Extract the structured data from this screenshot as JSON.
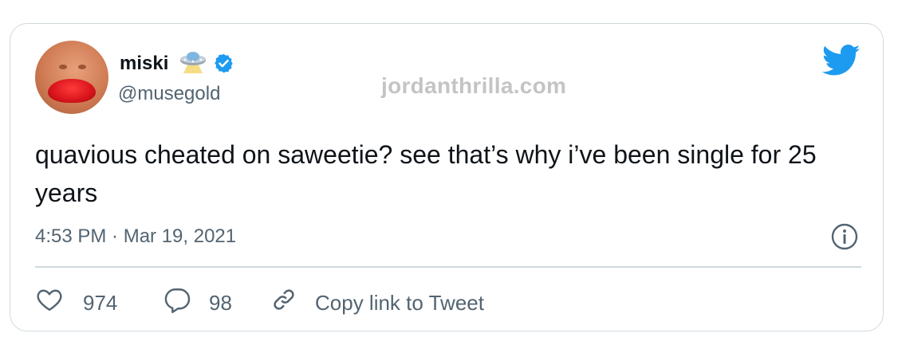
{
  "tweet": {
    "author": {
      "name": "miski",
      "handle": "@musegold",
      "badges": [
        "ufo-icon",
        "verified-icon"
      ]
    },
    "watermark": "jordanthrilla.com",
    "text": "quavious cheated on saweetie? see that’s why i’ve been single for 25 years",
    "timestamp": "4:53 PM · Mar 19, 2021",
    "actions": {
      "like_count": "974",
      "reply_count": "98",
      "copy_link_label": "Copy link to Tweet"
    }
  },
  "colors": {
    "twitter_blue": "#1d9bf0",
    "secondary_text": "#536471",
    "border": "#cfd9de"
  }
}
